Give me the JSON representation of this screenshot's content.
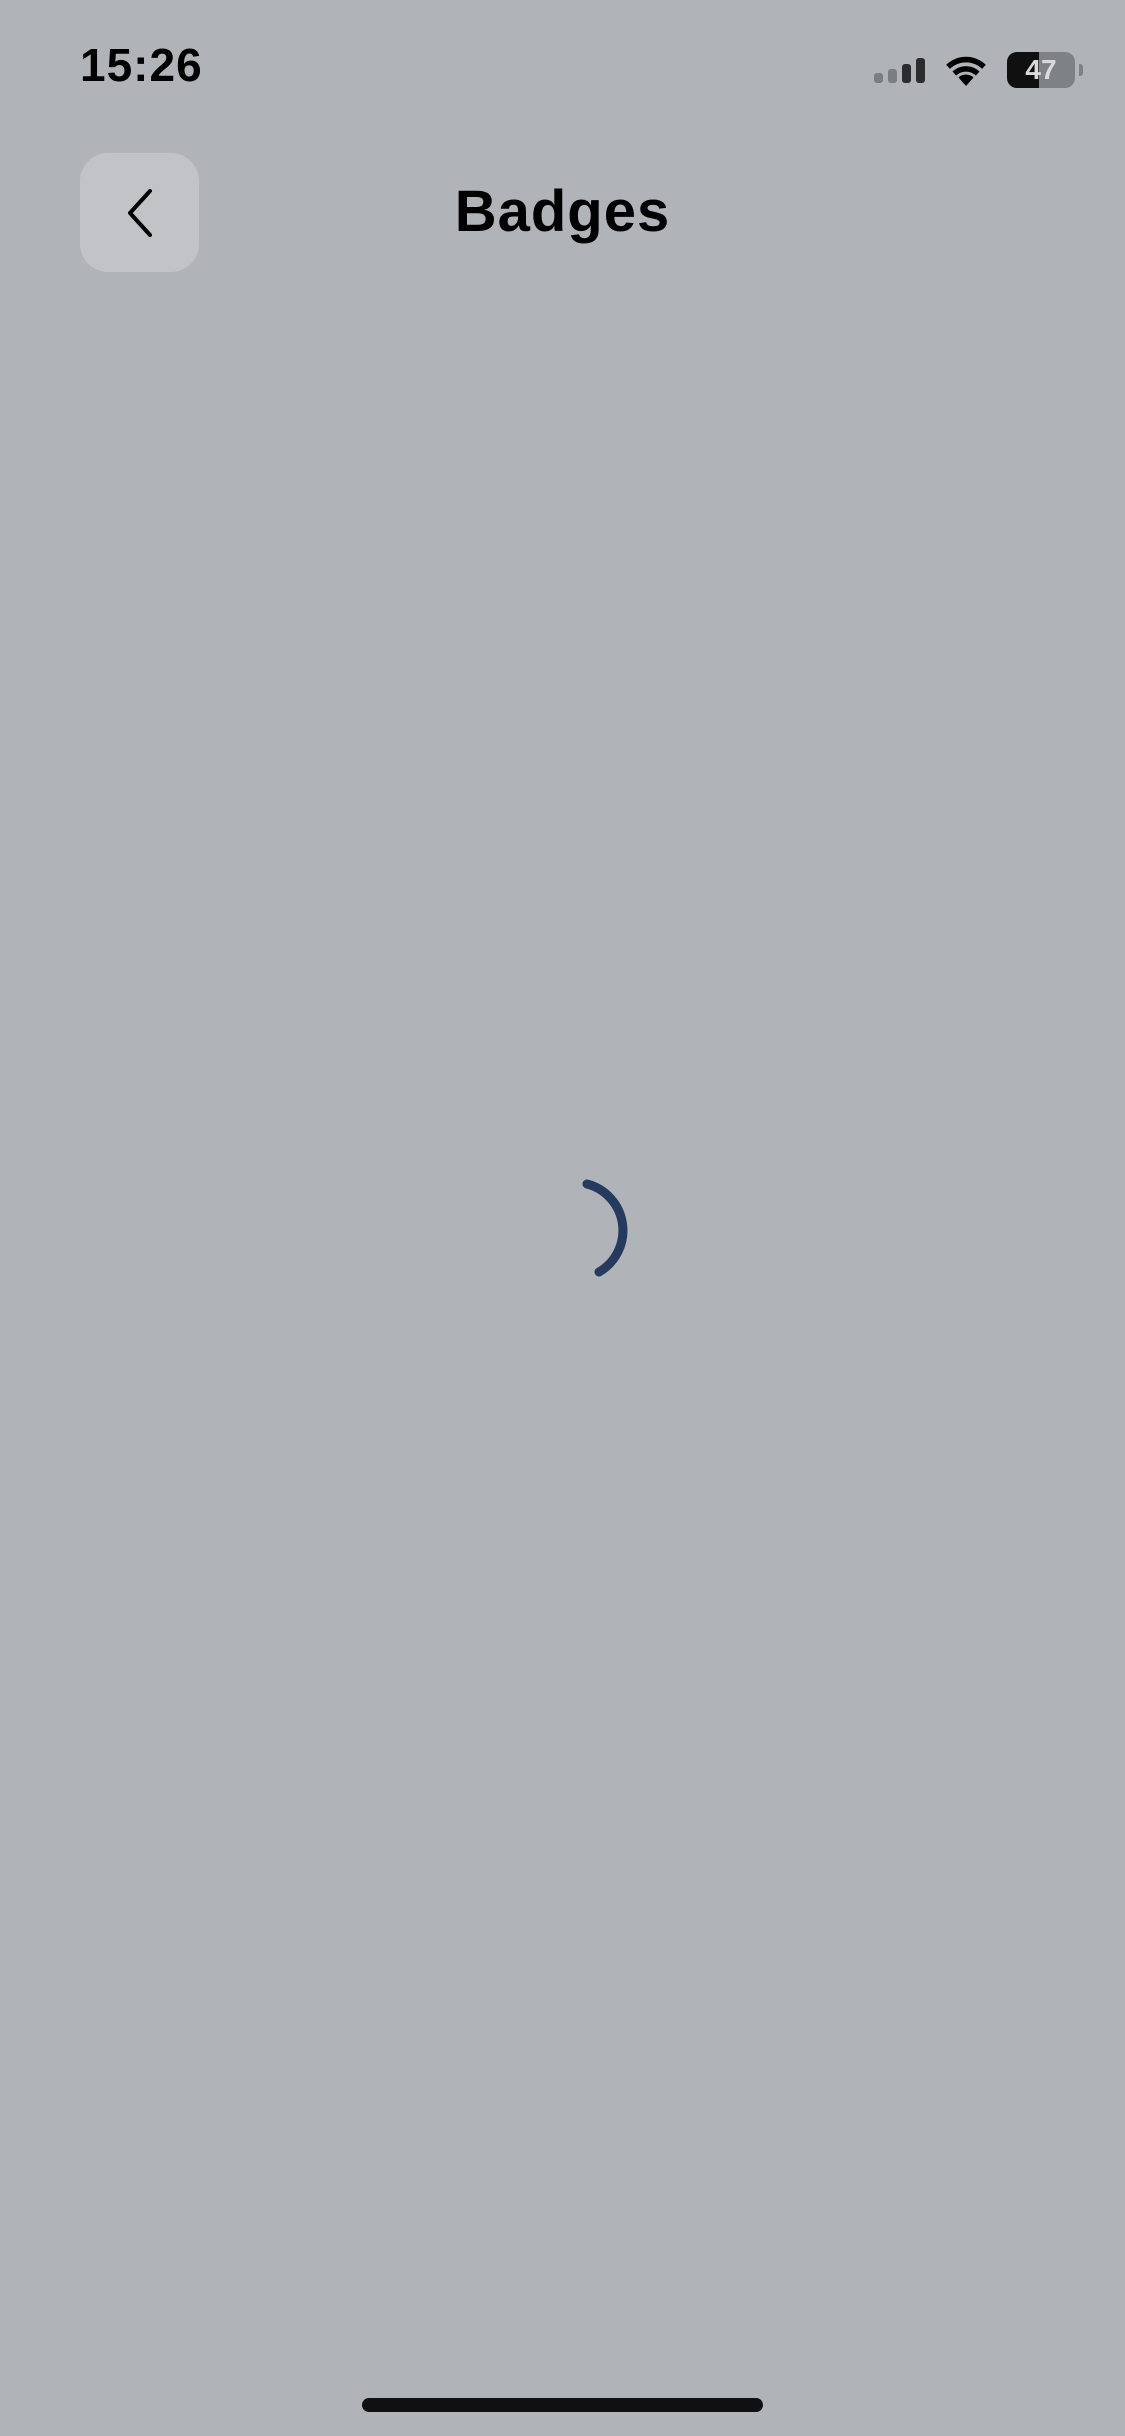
{
  "status_bar": {
    "time": "15:26",
    "battery_level": "47",
    "battery_fraction": 0.47,
    "icons": [
      "cellular-signal-icon",
      "wifi-icon",
      "battery-icon"
    ]
  },
  "header": {
    "title": "Badges",
    "back_icon": "chevron-left-icon"
  },
  "content": {
    "state": "loading",
    "spinner_color": "#243a5e"
  },
  "colors": {
    "background": "#b0b3b8",
    "back_button": "#c2c3c6",
    "text": "#000000"
  }
}
